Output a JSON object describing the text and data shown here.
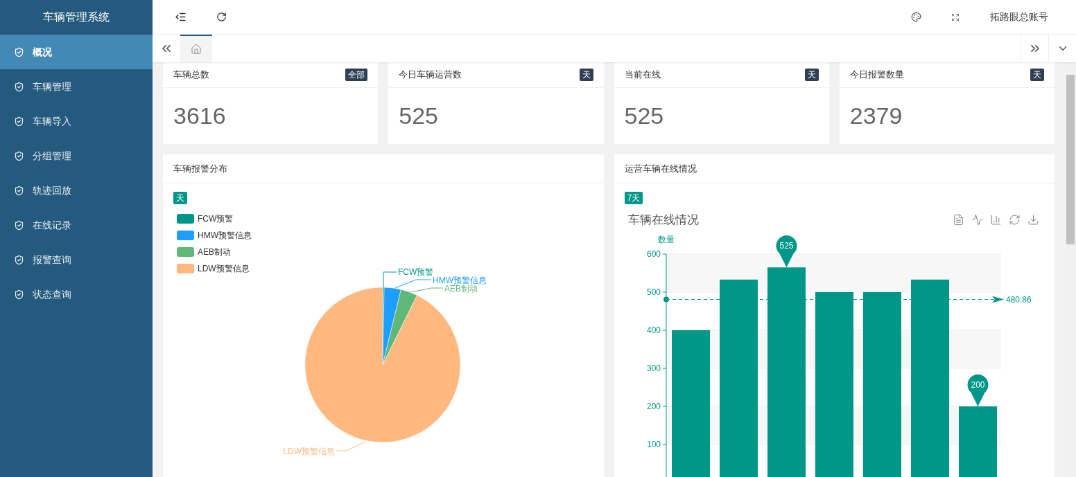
{
  "sidebar": {
    "title": "车辆管理系统",
    "items": [
      {
        "label": "概况",
        "selected": true
      },
      {
        "label": "车辆管理",
        "selected": false
      },
      {
        "label": "车辆导入",
        "selected": false
      },
      {
        "label": "分组管理",
        "selected": false
      },
      {
        "label": "轨迹回放",
        "selected": false
      },
      {
        "label": "在线记录",
        "selected": false
      },
      {
        "label": "报警查询",
        "selected": false
      },
      {
        "label": "状态查询",
        "selected": false
      }
    ]
  },
  "header": {
    "user": "拓路眼总账号"
  },
  "tabs": [
    {
      "kind": "home",
      "selected": true
    }
  ],
  "stats": [
    {
      "title": "车辆总数",
      "tag": "全部",
      "value": "3616"
    },
    {
      "title": "今日车辆运营数",
      "tag": "天",
      "value": "525"
    },
    {
      "title": "当前在线",
      "tag": "天",
      "value": "525"
    },
    {
      "title": "今日报警数量",
      "tag": "天",
      "value": "2379"
    }
  ],
  "alarm_panel": {
    "title": "车辆报警分布",
    "tag": "天",
    "legend": [
      {
        "label": "FCW预警",
        "color": "#009688"
      },
      {
        "label": "HMW预警信息",
        "color": "#1e9fff"
      },
      {
        "label": "AEB制动",
        "color": "#5fb878"
      },
      {
        "label": "LDW预警信息",
        "color": "#ffb980"
      }
    ],
    "slice_labels": [
      {
        "label": "FCW预警",
        "color": "#009688"
      },
      {
        "label": "HMW预警信息",
        "color": "#1e9fff"
      },
      {
        "label": "AEB制动",
        "color": "#5fb878"
      },
      {
        "label": "LDW预警信息",
        "color": "#ffb980"
      }
    ]
  },
  "online_panel": {
    "title": "运营车辆在线情况",
    "tag": "7天",
    "chart_data": {
      "type": "bar",
      "title": "车辆在线情况",
      "ylabel": "数量",
      "values": [
        400,
        533,
        565,
        500,
        500,
        533,
        200
      ],
      "ylim": [
        0,
        600
      ],
      "yticks": [
        100,
        200,
        300,
        400,
        500,
        600
      ],
      "grid": true,
      "ref_lines": [
        {
          "axis": "y",
          "value": 480.86,
          "label": "480.86"
        }
      ],
      "annotations": [
        {
          "text": "525",
          "y": 565
        },
        {
          "text": "200",
          "y": 200
        }
      ]
    }
  }
}
